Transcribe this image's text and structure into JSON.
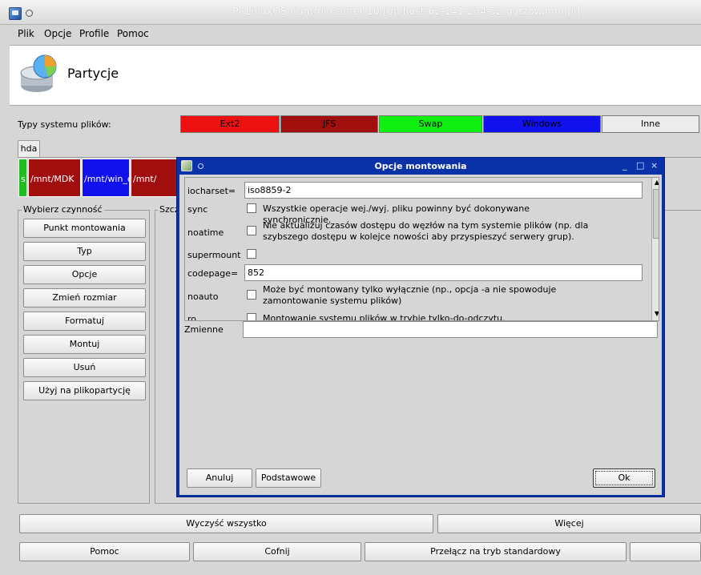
{
  "window": {
    "title": "PCLinuxOS Control Center 10 [on host-62-141-234-52.gorzow.mm.pl]"
  },
  "menubar": {
    "items": [
      "Plik",
      "Opcje",
      "Profile",
      "Pomoc"
    ]
  },
  "header": {
    "title": "Partycje"
  },
  "filesystems": {
    "label": "Typy systemu plików:",
    "types": [
      {
        "label": "Ext2",
        "color": "#ee1111"
      },
      {
        "label": "JFS",
        "color": "#a00e0e"
      },
      {
        "label": "Swap",
        "color": "#11ee11"
      },
      {
        "label": "Windows",
        "color": "#1111ee"
      },
      {
        "label": "Inne",
        "color": "#ededed"
      }
    ]
  },
  "disk": {
    "tab": "hda",
    "partitions": [
      {
        "label": "s",
        "color": "#22bb22"
      },
      {
        "label": "/mnt/MDK",
        "color": "#a00e0e"
      },
      {
        "label": "/mnt/win_c",
        "color": "#1111ee"
      },
      {
        "label": "/mnt/",
        "color": "#a00e0e"
      }
    ]
  },
  "actions": {
    "title": "Wybierz czynność",
    "buttons": [
      "Punkt montowania",
      "Typ",
      "Opcje",
      "Zmień rozmiar",
      "Formatuj",
      "Montuj",
      "Usuń",
      "Użyj na plikopartycję"
    ]
  },
  "details": {
    "title": "Szcz"
  },
  "bottom": {
    "clear_all": "Wyczyść wszystko",
    "more": "Więcej",
    "help": "Pomoc",
    "undo": "Cofnij",
    "standard_mode": "Przełącz na tryb standardowy"
  },
  "dialog": {
    "title": "Opcje montowania",
    "controls": [
      "_",
      "□",
      "×"
    ],
    "options": {
      "iocharset": {
        "label": "iocharset=",
        "value": "iso8859-2"
      },
      "sync": {
        "label": "sync",
        "desc": "Wszystkie operacje wej./wyj. pliku powinny być dokonywane synchronicznie."
      },
      "noatime": {
        "label": "noatime",
        "desc": "Nie aktualizuj czasów dostępu do węzłów na tym systemie plików (np. dla szybszego dostępu w kolejce nowości aby przyspieszyć serwery grup)."
      },
      "supermount": {
        "label": "supermount"
      },
      "codepage": {
        "label": "codepage=",
        "value": "852"
      },
      "noauto": {
        "label": "noauto",
        "desc": "Może być montowany tylko wyłącznie (np., opcja -a nie spowoduje zamontowanie systemu plików)"
      },
      "ro": {
        "label": "ro",
        "desc": "Montowanie systemu plików w trybie tylko-do-odczytu."
      }
    },
    "variables_label": "Zmienne",
    "variables_value": "",
    "cancel": "Anuluj",
    "basic": "Podstawowe",
    "ok": "Ok"
  }
}
